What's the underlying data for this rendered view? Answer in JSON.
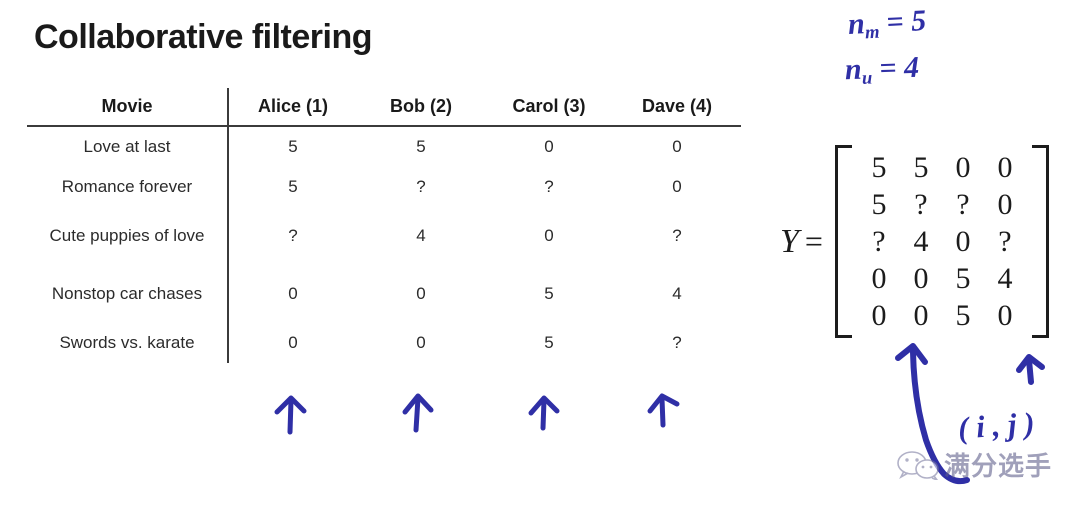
{
  "slide": {
    "title": "Collaborative filtering",
    "background_color": "#ffffff",
    "ink_color": "#2f2fa6",
    "rule_color": "#3b3b3b"
  },
  "table": {
    "headers": [
      "Movie",
      "Alice (1)",
      "Bob (2)",
      "Carol (3)",
      "Dave (4)"
    ],
    "rows": [
      {
        "movie": "Love at last",
        "ratings": [
          "5",
          "5",
          "0",
          "0"
        ]
      },
      {
        "movie": "Romance forever",
        "ratings": [
          "5",
          "?",
          "?",
          "0"
        ]
      },
      {
        "movie": "Cute puppies of love",
        "ratings": [
          "?",
          "4",
          "0",
          "?"
        ]
      },
      {
        "movie": "Nonstop car chases",
        "ratings": [
          "0",
          "0",
          "5",
          "4"
        ]
      },
      {
        "movie": "Swords vs. karate",
        "ratings": [
          "0",
          "0",
          "5",
          "?"
        ]
      }
    ]
  },
  "annotations": {
    "n_movies_label": "n",
    "n_movies_sub": "m",
    "n_movies_value": "= 5",
    "n_users_label": "n",
    "n_users_sub": "u",
    "n_users_value": "= 4",
    "index_pair": "( i , j )",
    "column_arrow_count": 4
  },
  "matrix": {
    "label": "Y",
    "equals": "=",
    "values": [
      [
        "5",
        "5",
        "0",
        "0"
      ],
      [
        "5",
        "?",
        "?",
        "0"
      ],
      [
        "?",
        "4",
        "0",
        "?"
      ],
      [
        "0",
        "0",
        "5",
        "4"
      ],
      [
        "0",
        "0",
        "5",
        "0"
      ]
    ]
  },
  "watermark": {
    "icon": "wechat-icon",
    "text": "满分选手"
  }
}
